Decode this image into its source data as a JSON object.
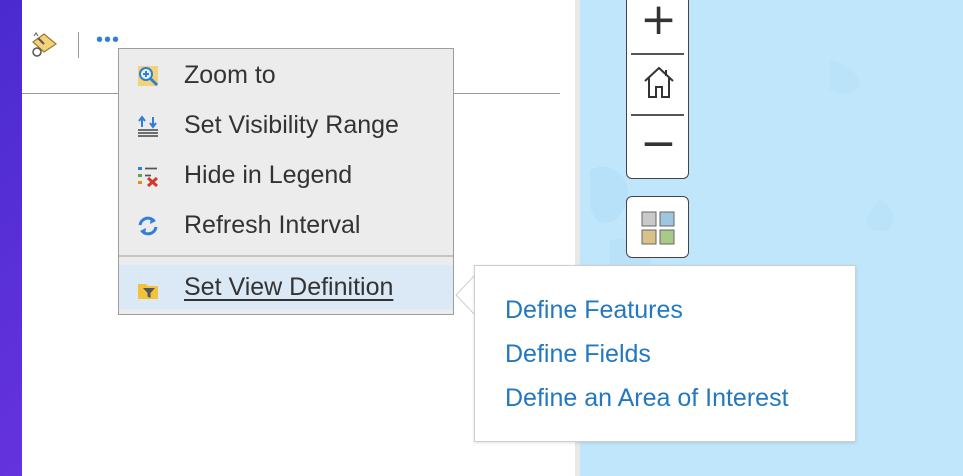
{
  "toolbar": {
    "more_label": "•••"
  },
  "context_menu": {
    "items": [
      {
        "label": "Zoom to",
        "icon": "zoom-to-icon"
      },
      {
        "label": "Set Visibility Range",
        "icon": "visibility-range-icon"
      },
      {
        "label": "Hide in Legend",
        "icon": "hide-legend-icon"
      },
      {
        "label": "Refresh Interval",
        "icon": "refresh-icon"
      },
      {
        "label": "Set View Definition",
        "icon": "view-definition-icon"
      }
    ]
  },
  "submenu": {
    "items": [
      {
        "label": "Define Features"
      },
      {
        "label": "Define Fields"
      },
      {
        "label": "Define an Area of Interest"
      }
    ]
  },
  "map_controls": {
    "zoom_in": "+",
    "zoom_out": "−"
  },
  "colors": {
    "accent": "#2378bf",
    "menu_bg": "#ececec",
    "active_bg": "#dbe9f6",
    "map_bg": "#bfe6fb",
    "frame": "#5a2bd6"
  }
}
